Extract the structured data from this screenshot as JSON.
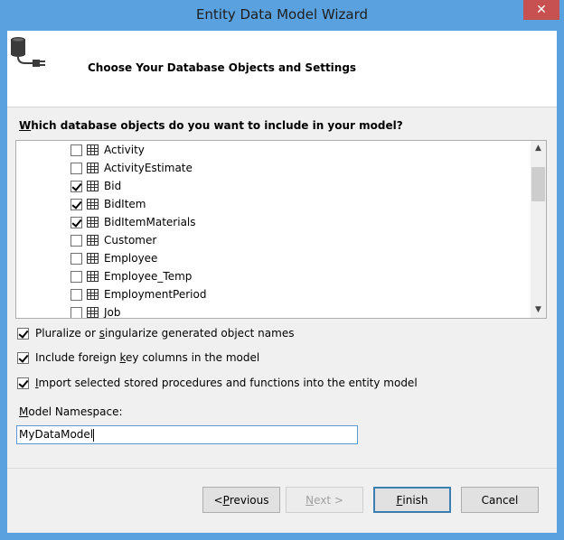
{
  "window": {
    "title": "Entity Data Model Wizard",
    "close_glyph": "✕"
  },
  "header": {
    "title": "Choose Your Database Objects and Settings"
  },
  "question": {
    "underlined": "W",
    "rest": "hich database objects do you want to include in your model?"
  },
  "objects": [
    {
      "label": "Activity",
      "checked": false
    },
    {
      "label": "ActivityEstimate",
      "checked": false
    },
    {
      "label": "Bid",
      "checked": true
    },
    {
      "label": "BidItem",
      "checked": true
    },
    {
      "label": "BidItemMaterials",
      "checked": true
    },
    {
      "label": "Customer",
      "checked": false
    },
    {
      "label": "Employee",
      "checked": false
    },
    {
      "label": "Employee_Temp",
      "checked": false
    },
    {
      "label": "EmploymentPeriod",
      "checked": false
    },
    {
      "label": "Job",
      "checked": false
    }
  ],
  "options": {
    "pluralize": {
      "before": "Pluralize or ",
      "underlined": "s",
      "after": "ingularize generated object names",
      "checked": true
    },
    "foreign_keys": {
      "before": "Include foreign ",
      "underlined": "k",
      "after": "ey columns in the model",
      "checked": true
    },
    "stored_procs": {
      "before": "",
      "underlined": "I",
      "after": "mport selected stored procedures and functions into the entity model",
      "checked": true
    }
  },
  "namespace": {
    "label_underlined": "M",
    "label_rest": "odel Namespace:",
    "value": "MyDataModel"
  },
  "buttons": {
    "previous": {
      "before": "< ",
      "underlined": "P",
      "after": "revious"
    },
    "next": {
      "before": "",
      "underlined": "N",
      "after": "ext >"
    },
    "finish": {
      "before": "",
      "underlined": "F",
      "after": "inish"
    },
    "cancel": {
      "label": "Cancel"
    }
  },
  "icons": {
    "database": "database-plug-icon",
    "table": "table-icon",
    "scroll_up": "▲",
    "scroll_down": "▼"
  }
}
